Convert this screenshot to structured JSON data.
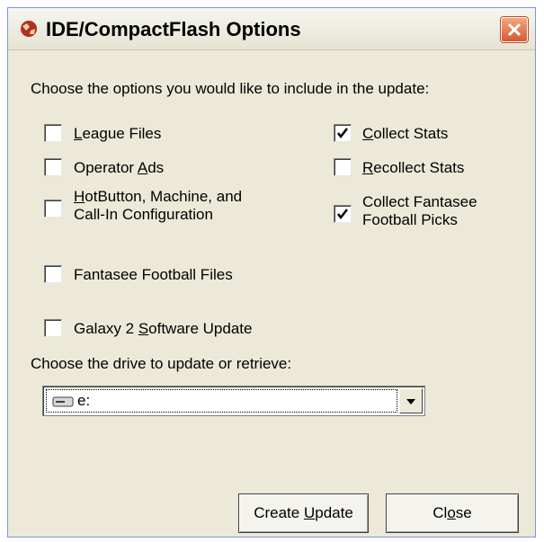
{
  "window": {
    "title": "IDE/CompactFlash Options",
    "icon": "app-globe-icon",
    "close_icon": "close-icon"
  },
  "instruction": "Choose the options you would like to include in the update:",
  "options_left": [
    {
      "pre": "",
      "u": "L",
      "post": "eague Files",
      "checked": false
    },
    {
      "pre": "Operator ",
      "u": "A",
      "post": "ds",
      "checked": false
    },
    {
      "pre": "",
      "u": "H",
      "post": "otButton, Machine, and",
      "line2": "Call-In Configuration",
      "checked": false
    },
    {
      "pre": "Fantasee Football Files",
      "u": "",
      "post": "",
      "checked": false
    },
    {
      "pre": "Galaxy 2 ",
      "u": "S",
      "post": "oftware Update",
      "checked": false
    }
  ],
  "options_right": [
    {
      "pre": "",
      "u": "C",
      "post": "ollect Stats",
      "checked": true
    },
    {
      "pre": "",
      "u": "R",
      "post": "ecollect Stats",
      "checked": false
    },
    {
      "pre": "Collect Fantasee",
      "u": "",
      "post": "",
      "line2": "Football Picks",
      "checked": true
    }
  ],
  "drive_label": "Choose the drive to update or retrieve:",
  "drive_select": {
    "value": "e:",
    "icon": "drive-icon"
  },
  "buttons": {
    "create": {
      "pre": "Create ",
      "u": "U",
      "post": "pdate"
    },
    "close": {
      "pre": "Cl",
      "u": "o",
      "post": "se"
    }
  },
  "colors": {
    "face": "#ece9d8",
    "close_red": "#d65a35",
    "border_blue": "#7a96df"
  }
}
